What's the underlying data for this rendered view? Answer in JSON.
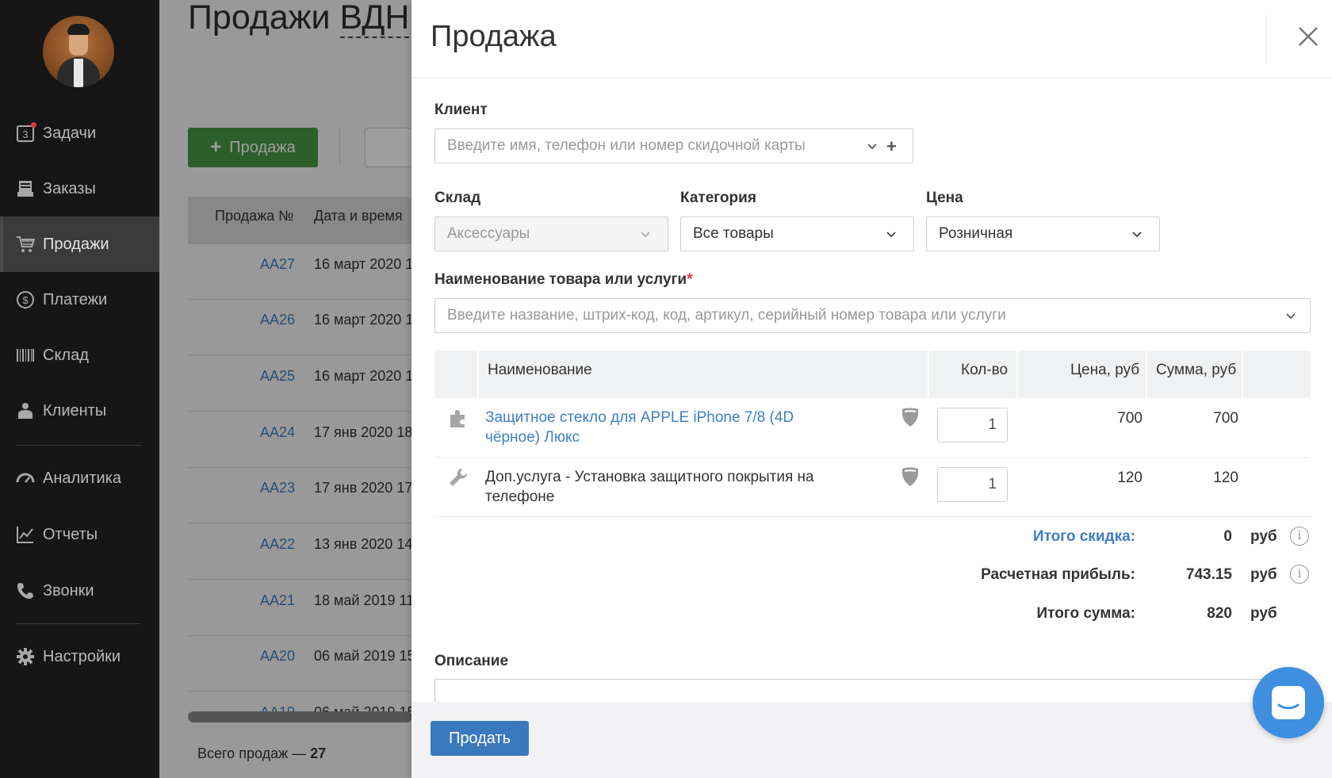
{
  "sidebar": {
    "items": [
      {
        "label": "Задачи",
        "icon": "tasks-icon",
        "badge": "3"
      },
      {
        "label": "Заказы",
        "icon": "orders-icon"
      },
      {
        "label": "Продажи",
        "icon": "cart-icon",
        "active": true
      },
      {
        "label": "Платежи",
        "icon": "dollar-icon"
      },
      {
        "label": "Склад",
        "icon": "barcode-icon"
      },
      {
        "label": "Клиенты",
        "icon": "user-icon"
      },
      {
        "label": "Аналитика",
        "icon": "gauge-icon"
      },
      {
        "label": "Отчеты",
        "icon": "chart-icon"
      },
      {
        "label": "Звонки",
        "icon": "phone-icon"
      },
      {
        "label": "Настройки",
        "icon": "gear-icon"
      }
    ]
  },
  "background": {
    "title_prefix": "Продажи ",
    "title_suffix": "ВДН",
    "add_sale_label": "Продажа",
    "table_headers": [
      "Продажа №",
      "Дата и время"
    ],
    "rows": [
      {
        "id": "АА27",
        "date": "16 март 2020 1"
      },
      {
        "id": "АА26",
        "date": "16 март 2020 1"
      },
      {
        "id": "АА25",
        "date": "16 март 2020 1"
      },
      {
        "id": "АА24",
        "date": "17 янв 2020 18"
      },
      {
        "id": "АА23",
        "date": "17 янв 2020 17"
      },
      {
        "id": "АА22",
        "date": "13 янв 2020 14"
      },
      {
        "id": "АА21",
        "date": "18 май 2019 11"
      },
      {
        "id": "АА20",
        "date": "06 май 2019 15"
      },
      {
        "id": "АА19",
        "date": "06 май 2019 15"
      }
    ],
    "total_label": "Всего продаж — ",
    "total_value": "27"
  },
  "modal": {
    "title": "Продажа",
    "client": {
      "label": "Клиент",
      "placeholder": "Введите имя, телефон или номер скидочной карты"
    },
    "warehouse": {
      "label": "Склад",
      "value": "Аксессуары"
    },
    "category": {
      "label": "Категория",
      "value": "Все товары"
    },
    "price_type": {
      "label": "Цена",
      "value": "Розничная"
    },
    "product": {
      "label": "Наименование товара или услуги",
      "required_mark": "*",
      "placeholder": "Введите название, штрих-код, код, артикул, серийный номер товара или услуги"
    },
    "table": {
      "headers": {
        "name": "Наименование",
        "qty": "Кол-во",
        "price": "Цена, руб",
        "sum": "Сумма, руб"
      },
      "items": [
        {
          "name": "Защитное стекло для APPLE iPhone 7/8 (4D чёрное) Люкс",
          "qty": "1",
          "price": "700",
          "sum": "700",
          "type_icon": "puzzle-icon",
          "is_link": true
        },
        {
          "name": "Доп.услуга - Установка защитного покрытия на телефоне",
          "qty": "1",
          "price": "120",
          "sum": "120",
          "type_icon": "wrench-icon",
          "is_link": false
        }
      ]
    },
    "summary": {
      "discount": {
        "label": "Итого скидка:",
        "value": "0",
        "currency": "руб"
      },
      "profit": {
        "label": "Расчетная прибыль:",
        "value": "743.15",
        "currency": "руб"
      },
      "total": {
        "label": "Итого сумма:",
        "value": "820",
        "currency": "руб"
      }
    },
    "description_label": "Описание",
    "sell_button": "Продать"
  },
  "colors": {
    "accent_blue": "#3a79bd",
    "green": "#4a9a45",
    "link": "#3f7ec4",
    "sidebar_bg": "#161616"
  }
}
